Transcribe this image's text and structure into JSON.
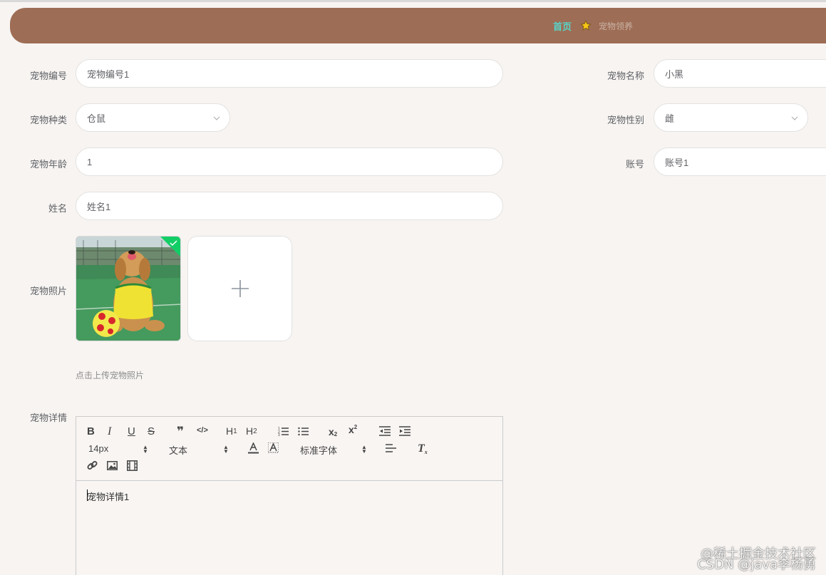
{
  "breadcrumb": {
    "home": "首页",
    "current": "宠物领养"
  },
  "form": {
    "pet_no": {
      "label": "宠物编号",
      "value": "宠物编号1"
    },
    "pet_name": {
      "label": "宠物名称",
      "value": "小黑"
    },
    "pet_type": {
      "label": "宠物种类",
      "value": "仓鼠"
    },
    "pet_gender": {
      "label": "宠物性别",
      "value": "雌"
    },
    "pet_age": {
      "label": "宠物年龄",
      "value": "1"
    },
    "account": {
      "label": "账号",
      "value": "账号1"
    },
    "name": {
      "label": "姓名",
      "value": "姓名1"
    },
    "photo": {
      "label": "宠物照片",
      "tip": "点击上传宠物照片"
    },
    "details": {
      "label": "宠物详情",
      "content": "宠物详情1"
    }
  },
  "editor": {
    "font_size": "14px",
    "block_format": "文本",
    "font_family": "标准字体",
    "buttons": [
      "bold-icon",
      "italic-icon",
      "underline-icon",
      "strike-icon",
      "blockquote-icon",
      "code-block-icon",
      "h1",
      "h2",
      "ordered-list-icon",
      "bullet-list-icon",
      "subscript-icon",
      "superscript-icon",
      "outdent-icon",
      "indent-icon",
      "font-color-icon",
      "background-color-icon",
      "align-icon",
      "clear-format-icon",
      "link-icon",
      "image-icon",
      "video-icon"
    ]
  },
  "watermark": {
    "line1": "@稀土掘金技术社区",
    "line2": "CSDN @java李杨勇"
  },
  "colors": {
    "header": "#9e6d55",
    "home_link": "#56d5c8",
    "upload_check": "#13ce66"
  }
}
